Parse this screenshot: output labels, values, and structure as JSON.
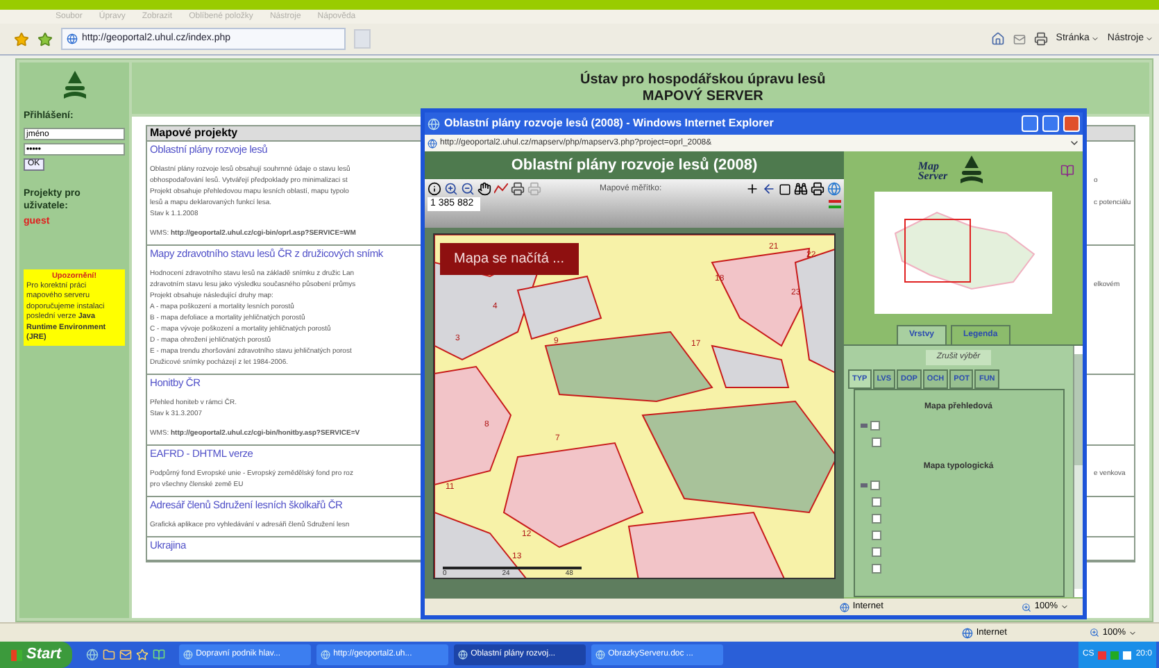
{
  "browser": {
    "menu": [
      "Soubor",
      "Úpravy",
      "Zobrazit",
      "Oblíbené položky",
      "Nástroje",
      "Nápověda"
    ],
    "address": "http://geoportal2.uhul.cz/index.php",
    "tools": [
      "Stránka",
      "Nástroje"
    ]
  },
  "sidebar": {
    "login_label": "Přihlášení:",
    "username_value": "jméno",
    "password_value": "•••••",
    "ok_button": "OK",
    "projects_label": "Projekty pro uživatele:",
    "user": "guest",
    "notice_title": "Upozornění!",
    "notice_text": "Pro korektní práci mapového serveru doporučujeme instalaci poslední verze **Java Runtime Environment (JRE)**"
  },
  "header": {
    "title": "Ústav pro hospodářskou úpravu lesů",
    "subtitle": "MAPOVÝ SERVER"
  },
  "projects": {
    "heading": "Mapové projekty",
    "items": [
      {
        "title": "Oblastní plány rozvoje lesů",
        "lines": [
          {
            "text": "Oblastní plány rozvoje lesů obsahují souhrnné údaje o stavu lesů"
          },
          {
            "text": "obhospodařování lesů. Vytvářejí předpoklady pro minimalizaci st",
            "aside": "o"
          },
          {
            "text": "Projekt obsahuje přehledovou mapu lesních oblastí, mapu typolo"
          },
          {
            "text": "lesů a mapu deklarovaných funkcí lesa.",
            "aside": "c potenciálu"
          },
          {
            "text": "Stav k 1.1.2008"
          },
          {
            "text": "WMS: **http://geoportal2.uhul.cz/cgi-bin/oprl.asp?SERVICE=WM**",
            "gap": true
          }
        ]
      },
      {
        "title": "Mapy zdravotního stavu lesů ČR z družicových snímk",
        "lines": [
          {
            "text": "Hodnocení zdravotního stavu lesů na základě snímku z družic Lan"
          },
          {
            "text": "zdravotním stavu lesu jako výsledku současného působení průmys",
            "aside": "elkovém"
          },
          {
            "text": "Projekt obsahuje následující druhy map:"
          },
          {
            "text": "A - mapa poškození a mortality lesních porostů"
          },
          {
            "text": "B - mapa defoliace a mortality jehličnatých porostů"
          },
          {
            "text": "C - mapa vývoje poškození a mortality jehličnatých porostů"
          },
          {
            "text": "D - mapa ohrožení jehličnatých porostů"
          },
          {
            "text": "E - mapa trendu zhoršování zdravotního stavu jehličnatých porost"
          },
          {
            "text": "Družicové snímky pocházejí z let 1984-2006."
          }
        ]
      },
      {
        "title": "Honitby ČR",
        "lines": [
          {
            "text": "Přehled honiteb v rámci ČR."
          },
          {
            "text": "Stav k 31.3.2007"
          },
          {
            "text": "WMS: **http://geoportal2.uhul.cz/cgi-bin/honitby.asp?SERVICE=V**",
            "gap": true
          }
        ]
      },
      {
        "title": "EAFRD - DHTML verze",
        "lines": [
          {
            "text": "Podpůrný fond Evropské unie - Evropský zemědělský fond pro roz",
            "aside": "e venkova"
          },
          {
            "text": "pro všechny členské země EU"
          }
        ]
      },
      {
        "title": "Adresář členů Sdružení lesních školkařů ČR",
        "lines": [
          {
            "text": "Grafická aplikace pro vyhledávání v adresáři členů Sdružení lesn"
          }
        ]
      },
      {
        "title": "Ukrajina"
      }
    ]
  },
  "popup": {
    "title": "Oblastní plány rozvoje lesů (2008) - Windows Internet Explorer",
    "address": "http://geoportal2.uhul.cz/mapserv/php/mapserv3.php?project=oprl_2008&",
    "map_title": "Oblastní plány rozvoje lesů (2008)",
    "scale_label": "Mapové měřítko:",
    "scale_value": "1 385 882",
    "loading": "Mapa se načítá ...",
    "map_labels": [
      "21",
      "22",
      "18",
      "23",
      "4",
      "3",
      "17",
      "9",
      "8",
      "7",
      "11",
      "12",
      "13"
    ],
    "scale_ticks": [
      "0",
      "24",
      "48"
    ],
    "logo": [
      "Map",
      "Server"
    ],
    "tabs": [
      {
        "label": "Vrstvy",
        "selected": true
      },
      {
        "label": "Legenda",
        "selected": false
      }
    ],
    "clear_button": "Zrušit výběr",
    "layer_tabs": [
      {
        "label": "TYP",
        "selected": true
      },
      {
        "label": "LVS",
        "selected": false
      },
      {
        "label": "DOP",
        "selected": false
      },
      {
        "label": "OCH",
        "selected": false
      },
      {
        "label": "POT",
        "selected": false
      },
      {
        "label": "FUN",
        "selected": false
      }
    ],
    "groups": [
      {
        "title": "Mapa přehledová",
        "checked": false,
        "items": [
          {
            "checked": false
          }
        ]
      },
      {
        "title": "Mapa typologická",
        "checked": false,
        "items": [
          {
            "checked": false
          },
          {
            "checked": false
          },
          {
            "checked": false
          },
          {
            "checked": false
          },
          {
            "checked": false
          }
        ]
      }
    ],
    "status": "Internet",
    "zoom": "100%"
  },
  "status_bar": {
    "zone": "Internet",
    "zoom": "100%"
  },
  "taskbar": {
    "start": "Start",
    "tasks": [
      {
        "label": "Dopravní podnik hlav...",
        "selected": false
      },
      {
        "label": "http://geoportal2.uh...",
        "selected": false
      },
      {
        "label": "Oblastní plány rozvoj...",
        "selected": true
      },
      {
        "label": "ObrazkyServeru.doc ...",
        "selected": false
      }
    ],
    "language": "CS",
    "clock": "20:0"
  }
}
